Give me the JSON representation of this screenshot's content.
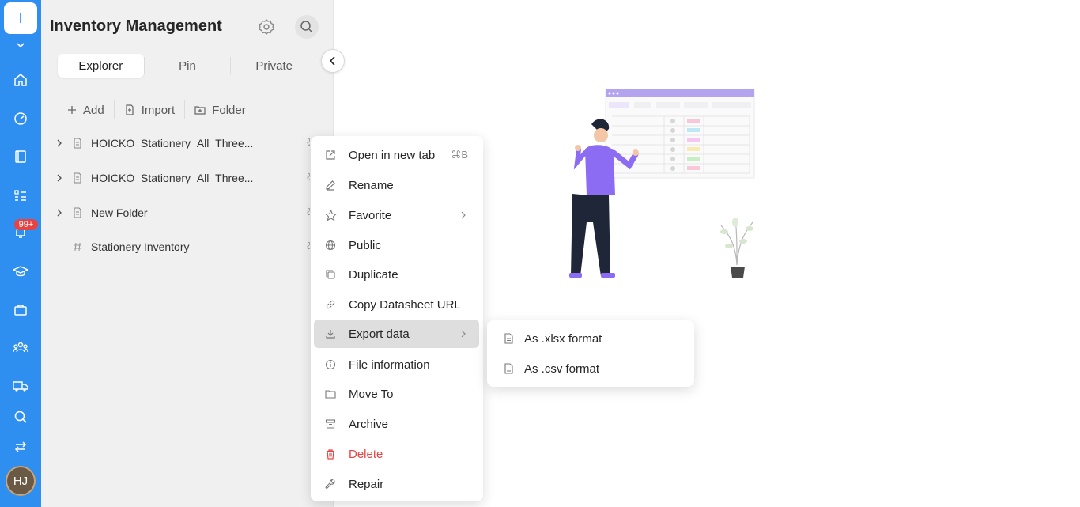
{
  "space": {
    "initial": "I"
  },
  "rail": {
    "icons": [
      "chevron-down-icon",
      "home-icon",
      "dashboard-icon",
      "book-icon",
      "list-icon",
      "bell-icon",
      "graduation-cap-icon",
      "briefcase-icon",
      "team-icon",
      "truck-icon",
      "search-icon",
      "swap-icon"
    ],
    "notification_badge": "99+",
    "avatar_initials": "HJ",
    "accent_color": "#2f8ff0"
  },
  "sidebar": {
    "title": "Inventory Management",
    "tabs": [
      {
        "label": "Explorer",
        "active": true
      },
      {
        "label": "Pin",
        "active": false
      },
      {
        "label": "Private",
        "active": false
      }
    ],
    "actions": [
      {
        "label": "Add",
        "icon": "plus-icon"
      },
      {
        "label": "Import",
        "icon": "import-icon"
      },
      {
        "label": "Folder",
        "icon": "folder-add-icon"
      }
    ],
    "tree": [
      {
        "label": "HOICKO_Stationery_All_Three...",
        "icon": "folder-icon",
        "expandable": true
      },
      {
        "label": "HOICKO_Stationery_All_Three...",
        "icon": "folder-icon",
        "expandable": true
      },
      {
        "label": "New Folder",
        "icon": "folder-icon",
        "expandable": true
      },
      {
        "label": "Stationery Inventory",
        "icon": "hash-icon",
        "expandable": false
      }
    ]
  },
  "context_menu": {
    "items": [
      {
        "label": "Open in new tab",
        "icon": "external-link-icon",
        "shortcut": "⌘B"
      },
      {
        "label": "Rename",
        "icon": "edit-icon"
      },
      {
        "label": "Favorite",
        "icon": "star-icon",
        "submenu": true
      },
      {
        "label": "Public",
        "icon": "globe-icon"
      },
      {
        "label": "Duplicate",
        "icon": "copy-icon"
      },
      {
        "label": "Copy Datasheet URL",
        "icon": "link-icon"
      },
      {
        "label": "Export data",
        "icon": "download-icon",
        "submenu": true,
        "highlighted": true
      },
      {
        "label": "File information",
        "icon": "info-icon"
      },
      {
        "label": "Move To",
        "icon": "folder-move-icon"
      },
      {
        "label": "Archive",
        "icon": "archive-icon"
      },
      {
        "label": "Delete",
        "icon": "trash-icon",
        "danger": true
      },
      {
        "label": "Repair",
        "icon": "wrench-icon"
      }
    ],
    "danger_color": "#e84343"
  },
  "export_submenu": {
    "items": [
      {
        "label": "As .xlsx format",
        "icon": "xlsx-file-icon"
      },
      {
        "label": "As .csv format",
        "icon": "csv-file-icon"
      }
    ]
  }
}
